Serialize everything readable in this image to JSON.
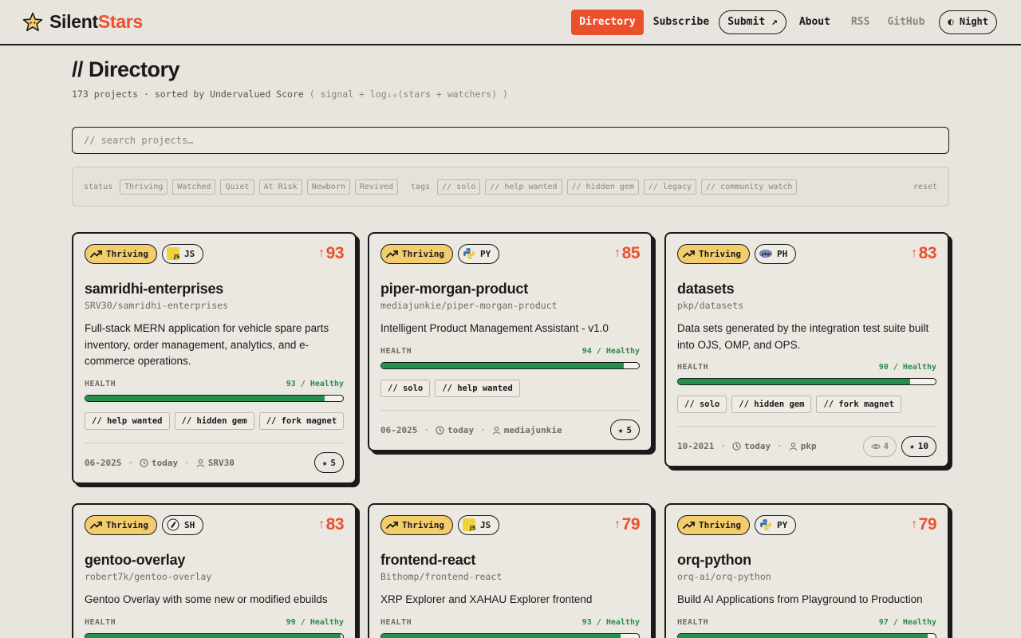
{
  "header": {
    "brand_a": "Silent",
    "brand_b": "Stars",
    "nav": {
      "directory": "Directory",
      "subscribe": "Subscribe",
      "submit": "Submit ↗",
      "about": "About",
      "rss": "RSS",
      "github": "GitHub",
      "night": "◐ Night"
    }
  },
  "page": {
    "title": "// Directory",
    "count": "173 projects · sorted by Undervalued Score",
    "formula": "( signal ÷ log₁₀(stars + watchers) )"
  },
  "search": {
    "placeholder": "// search projects…"
  },
  "filters": {
    "status_label": "status",
    "status": [
      "Thriving",
      "Watched",
      "Quiet",
      "At Risk",
      "Newborn",
      "Revived"
    ],
    "tags_label": "tags",
    "tags": [
      "// solo",
      "// help wanted",
      "// hidden gem",
      "// legacy",
      "// community watch"
    ],
    "reset": "reset"
  },
  "colors": {
    "accent": "#ec4f2e",
    "thriving": "#f3cd6b",
    "health": "#23914b"
  },
  "cards": [
    {
      "status": "Thriving",
      "lang": "JS",
      "lang_icon": "js-icon",
      "score": "93",
      "name": "samridhi-enterprises",
      "slug": "SRV30/samridhi-enterprises",
      "desc": "Full-stack MERN application for vehicle spare parts inventory, order management, analytics, and e-commerce operations.",
      "health_label": "HEALTH",
      "health_text": "93 / Healthy",
      "health": 93,
      "tags": [
        "// help wanted",
        "// hidden gem",
        "// fork magnet"
      ],
      "date": "06-2025",
      "updated": "today",
      "owner": "SRV30",
      "stars": "5"
    },
    {
      "status": "Thriving",
      "lang": "PY",
      "lang_icon": "python-icon",
      "score": "85",
      "name": "piper-morgan-product",
      "slug": "mediajunkie/piper-morgan-product",
      "desc": "Intelligent Product Management Assistant - v1.0",
      "health_label": "HEALTH",
      "health_text": "94 / Healthy",
      "health": 94,
      "tags": [
        "// solo",
        "// help wanted"
      ],
      "date": "06-2025",
      "updated": "today",
      "owner": "mediajunkie",
      "stars": "5"
    },
    {
      "status": "Thriving",
      "lang": "PH",
      "lang_icon": "php-icon",
      "score": "83",
      "name": "datasets",
      "slug": "pkp/datasets",
      "desc": "Data sets generated by the integration test suite built into OJS, OMP, and OPS.",
      "health_label": "HEALTH",
      "health_text": "90 / Healthy",
      "health": 90,
      "tags": [
        "// solo",
        "// hidden gem",
        "// fork magnet"
      ],
      "date": "10-2021",
      "updated": "today",
      "owner": "pkp",
      "watchers": "4",
      "stars": "10"
    },
    {
      "status": "Thriving",
      "lang": "SH",
      "lang_icon": "shell-icon",
      "score": "83",
      "name": "gentoo-overlay",
      "slug": "robert7k/gentoo-overlay",
      "desc": "Gentoo Overlay with some new or modified ebuilds",
      "health_label": "HEALTH",
      "health_text": "99 / Healthy",
      "health": 99
    },
    {
      "status": "Thriving",
      "lang": "JS",
      "lang_icon": "js-icon",
      "score": "79",
      "name": "frontend-react",
      "slug": "Bithomp/frontend-react",
      "desc": "XRP Explorer and XAHAU Explorer frontend",
      "health_label": "HEALTH",
      "health_text": "93 / Healthy",
      "health": 93
    },
    {
      "status": "Thriving",
      "lang": "PY",
      "lang_icon": "python-icon",
      "score": "79",
      "name": "orq-python",
      "slug": "orq-ai/orq-python",
      "desc": "Build AI Applications from Playground to Production",
      "health_label": "HEALTH",
      "health_text": "97 / Healthy",
      "health": 97
    }
  ]
}
